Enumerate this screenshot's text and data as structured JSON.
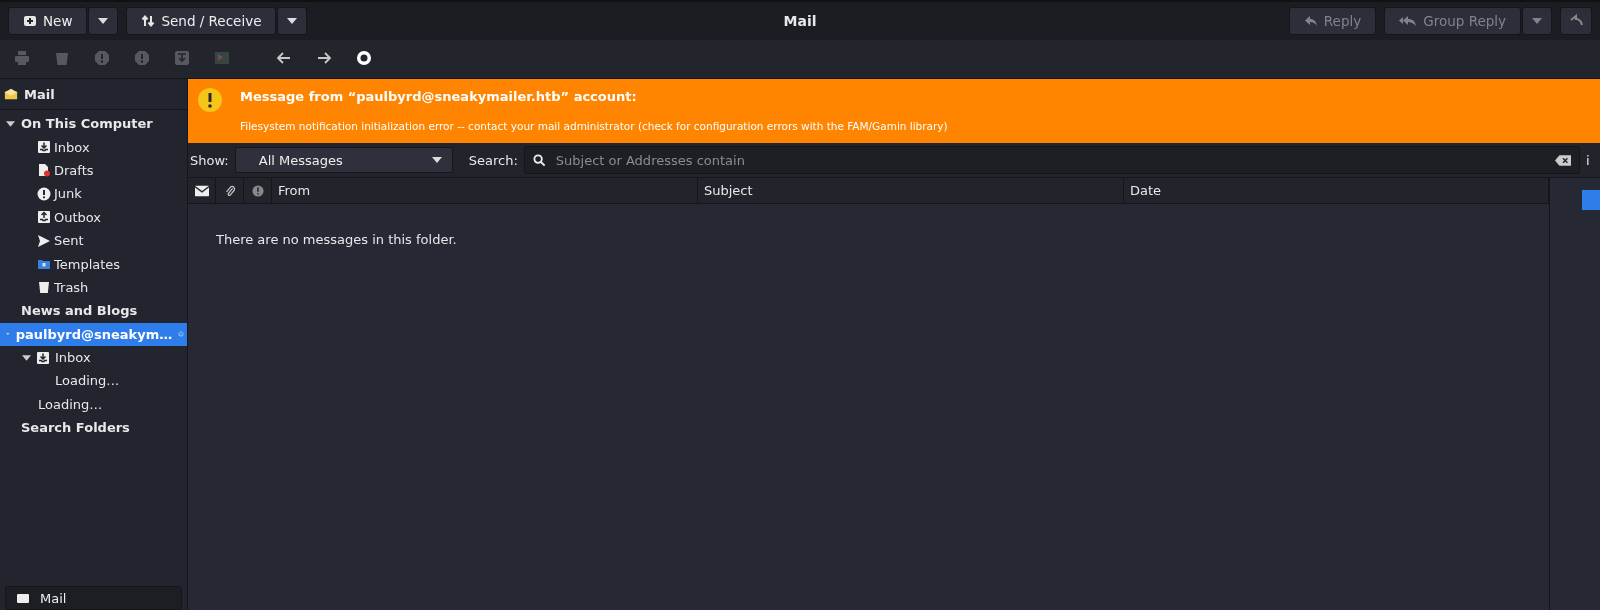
{
  "header": {
    "left_buttons": [
      {
        "kind": "new",
        "label": "New",
        "disabled": false,
        "has_menu": true
      },
      {
        "kind": "send-receive",
        "label": "Send / Receive",
        "disabled": false,
        "has_menu": true
      }
    ],
    "title": "Mail",
    "right_buttons": [
      {
        "kind": "reply",
        "label": "Reply",
        "disabled": true,
        "has_menu": false
      },
      {
        "kind": "group-reply",
        "label": "Group Reply",
        "disabled": true,
        "has_menu": true
      }
    ]
  },
  "toolbar": [
    {
      "kind": "print",
      "disabled": true
    },
    {
      "kind": "delete",
      "disabled": true
    },
    {
      "kind": "junk",
      "disabled": true
    },
    {
      "kind": "not-junk",
      "disabled": true
    },
    {
      "kind": "archive",
      "disabled": true
    },
    {
      "kind": "terminal",
      "disabled": true
    },
    {
      "kind": "back",
      "disabled": false
    },
    {
      "kind": "forward",
      "disabled": false
    },
    {
      "kind": "stop",
      "disabled": false
    }
  ],
  "sidebar": {
    "title": "Mail",
    "tree": [
      {
        "label": "On This Computer",
        "kind": "group",
        "selected": false,
        "loading": false,
        "expanded": true,
        "children": [
          {
            "label": "Inbox",
            "kind": "inbox"
          },
          {
            "label": "Drafts",
            "kind": "drafts"
          },
          {
            "label": "Junk",
            "kind": "junk"
          },
          {
            "label": "Outbox",
            "kind": "outbox"
          },
          {
            "label": "Sent",
            "kind": "sent"
          },
          {
            "label": "Templates",
            "kind": "templates"
          },
          {
            "label": "Trash",
            "kind": "trash"
          }
        ]
      },
      {
        "label": "News and Blogs",
        "kind": "group",
        "selected": false,
        "loading": false
      },
      {
        "label": "paulbyrd@sneakym…",
        "kind": "group",
        "selected": true,
        "loading": true,
        "expanded": true,
        "children": [
          {
            "label": "Inbox",
            "kind": "inbox",
            "expanded": true,
            "children": [
              {
                "label": "Loading…",
                "kind": "plain"
              }
            ]
          },
          {
            "label": "Loading…",
            "kind": "plain"
          }
        ]
      },
      {
        "label": "Search Folders",
        "kind": "group",
        "selected": false,
        "loading": false
      }
    ],
    "switcher": "Mail"
  },
  "banner": {
    "title": "Message from “paulbyrd@sneakymailer.htb” account:",
    "detail": "Filesystem notification initialization error -- contact your mail administrator (check for configuration errors with the FAM/Gamin library)"
  },
  "filter": {
    "show_label": "Show:",
    "show_value": "All Messages",
    "search_label": "Search:",
    "search_placeholder": "Subject or Addresses contain",
    "trailing": "i"
  },
  "message_list": {
    "icon_columns": [
      {
        "kind": "envelope"
      },
      {
        "kind": "attachment"
      },
      {
        "kind": "important"
      }
    ],
    "columns": [
      "From",
      "Subject",
      "Date"
    ],
    "empty_text": "There are no messages in this folder."
  }
}
